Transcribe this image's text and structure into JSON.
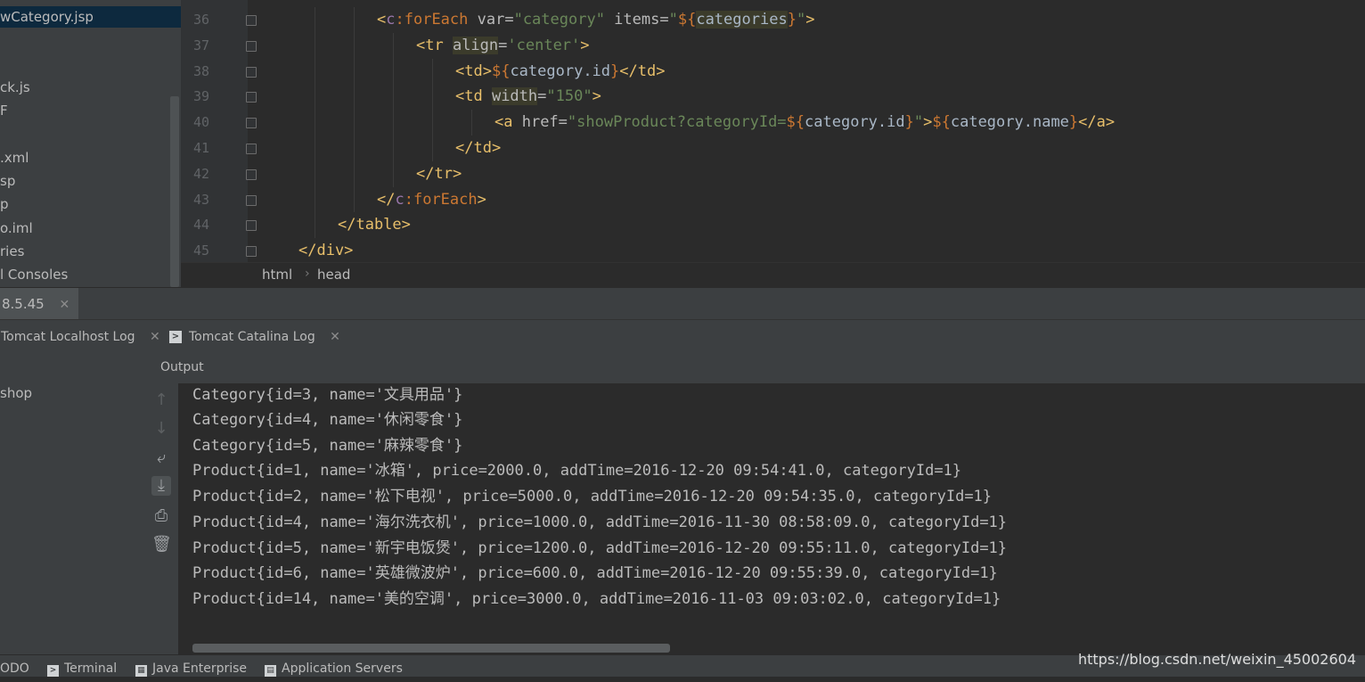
{
  "project_tree": {
    "items": [
      {
        "label": "wCategory.jsp",
        "selected": true
      },
      {
        "label": "ck.js"
      },
      {
        "label": "F"
      },
      {
        "label": ".xml"
      },
      {
        "label": "sp"
      },
      {
        "label": "p"
      },
      {
        "label": "o.iml"
      },
      {
        "label": "ries"
      },
      {
        "label": "l Consoles"
      }
    ]
  },
  "editor": {
    "line_numbers": [
      "36",
      "37",
      "38",
      "39",
      "40",
      "41",
      "42",
      "43",
      "44",
      "45"
    ],
    "lines": [
      [
        {
          "t": "<",
          "c": "tk-tag"
        },
        {
          "t": "c",
          "c": "tk-ns"
        },
        {
          "t": ":forEach ",
          "c": "tk-el"
        },
        {
          "t": "var=",
          "c": "tk-attr"
        },
        {
          "t": "\"category\"",
          "c": "tk-str"
        },
        {
          "t": " items=",
          "c": "tk-attr"
        },
        {
          "t": "\"",
          "c": "tk-str"
        },
        {
          "t": "${",
          "c": "tk-el"
        },
        {
          "t": "categories",
          "c": "tk-hl2"
        },
        {
          "t": "}",
          "c": "tk-el"
        },
        {
          "t": "\"",
          "c": "tk-str"
        },
        {
          "t": ">",
          "c": "tk-tag"
        }
      ],
      [
        {
          "t": "<tr ",
          "c": "tk-tag"
        },
        {
          "t": "align",
          "c": "tk-hl"
        },
        {
          "t": "=",
          "c": "tk-attr"
        },
        {
          "t": "'center'",
          "c": "tk-str"
        },
        {
          "t": ">",
          "c": "tk-tag"
        }
      ],
      [
        {
          "t": "<td>",
          "c": "tk-tag"
        },
        {
          "t": "${",
          "c": "tk-el"
        },
        {
          "t": "category.id",
          "c": "tk-text"
        },
        {
          "t": "}",
          "c": "tk-el"
        },
        {
          "t": "</td>",
          "c": "tk-tag"
        }
      ],
      [
        {
          "t": "<td ",
          "c": "tk-tag"
        },
        {
          "t": "width",
          "c": "tk-hl"
        },
        {
          "t": "=",
          "c": "tk-attr"
        },
        {
          "t": "\"150\"",
          "c": "tk-str"
        },
        {
          "t": ">",
          "c": "tk-tag"
        }
      ],
      [
        {
          "t": "<a ",
          "c": "tk-tag"
        },
        {
          "t": "href=",
          "c": "tk-attr"
        },
        {
          "t": "\"showProduct?categoryId=",
          "c": "tk-str"
        },
        {
          "t": "${",
          "c": "tk-el"
        },
        {
          "t": "category.id",
          "c": "tk-text"
        },
        {
          "t": "}",
          "c": "tk-el"
        },
        {
          "t": "\"",
          "c": "tk-str"
        },
        {
          "t": ">",
          "c": "tk-tag"
        },
        {
          "t": "${",
          "c": "tk-el"
        },
        {
          "t": "category.name",
          "c": "tk-text"
        },
        {
          "t": "}",
          "c": "tk-el"
        },
        {
          "t": "</a>",
          "c": "tk-tag"
        }
      ],
      [
        {
          "t": "</td>",
          "c": "tk-tag"
        }
      ],
      [
        {
          "t": "</tr>",
          "c": "tk-tag"
        }
      ],
      [
        {
          "t": "</",
          "c": "tk-tag"
        },
        {
          "t": "c",
          "c": "tk-ns"
        },
        {
          "t": ":forEach",
          "c": "tk-el"
        },
        {
          "t": ">",
          "c": "tk-tag"
        }
      ],
      [
        {
          "t": "</table>",
          "c": "tk-tag"
        }
      ],
      [
        {
          "t": "</div>",
          "c": "tk-tag"
        }
      ]
    ],
    "indent_levels": [
      2,
      3,
      4,
      4,
      5,
      4,
      3,
      2,
      1,
      0
    ],
    "breadcrumb": [
      "html",
      "head"
    ]
  },
  "run_window": {
    "tab_label": "8.5.45",
    "subtabs": [
      {
        "label": "Tomcat Localhost Log",
        "icon": "terminal-icon"
      },
      {
        "label": "Tomcat Catalina Log",
        "icon": "terminal-icon"
      }
    ],
    "deployment_item": "shop",
    "output_tab": "Output",
    "console_lines": [
      "Category{id=3, name='文具用品'}",
      "Category{id=4, name='休闲零食'}",
      "Category{id=5, name='麻辣零食'}",
      "Product{id=1, name='冰箱', price=2000.0, addTime=2016-12-20 09:54:41.0, categoryId=1}",
      "Product{id=2, name='松下电视', price=5000.0, addTime=2016-12-20 09:54:35.0, categoryId=1}",
      "Product{id=4, name='海尔洗衣机', price=1000.0, addTime=2016-11-30 08:58:09.0, categoryId=1}",
      "Product{id=5, name='新宇电饭煲', price=1200.0, addTime=2016-12-20 09:55:11.0, categoryId=1}",
      "Product{id=6, name='英雄微波炉', price=600.0, addTime=2016-12-20 09:55:39.0, categoryId=1}",
      "Product{id=14, name='美的空调', price=3000.0, addTime=2016-11-03 09:03:02.0, categoryId=1}"
    ],
    "toolbar_icons": [
      "arrow-up-icon",
      "arrow-down-icon",
      "soft-wrap-icon",
      "scroll-to-end-icon",
      "print-icon",
      "trash-icon"
    ]
  },
  "bottom_bar": {
    "items": [
      {
        "label": "ODO",
        "icon": ""
      },
      {
        "label": "Terminal",
        "icon": "terminal-icon"
      },
      {
        "label": "Java Enterprise",
        "icon": "java-enterprise-icon"
      },
      {
        "label": "Application Servers",
        "icon": "app-servers-icon"
      }
    ],
    "watermark": "https://blog.csdn.net/weixin_45002604"
  },
  "colors": {
    "editor_bg": "#2b2b2b",
    "panel_bg": "#3c3f41",
    "tag": "#e8bf6a",
    "string": "#6a8759",
    "keyword": "#cc7832"
  }
}
